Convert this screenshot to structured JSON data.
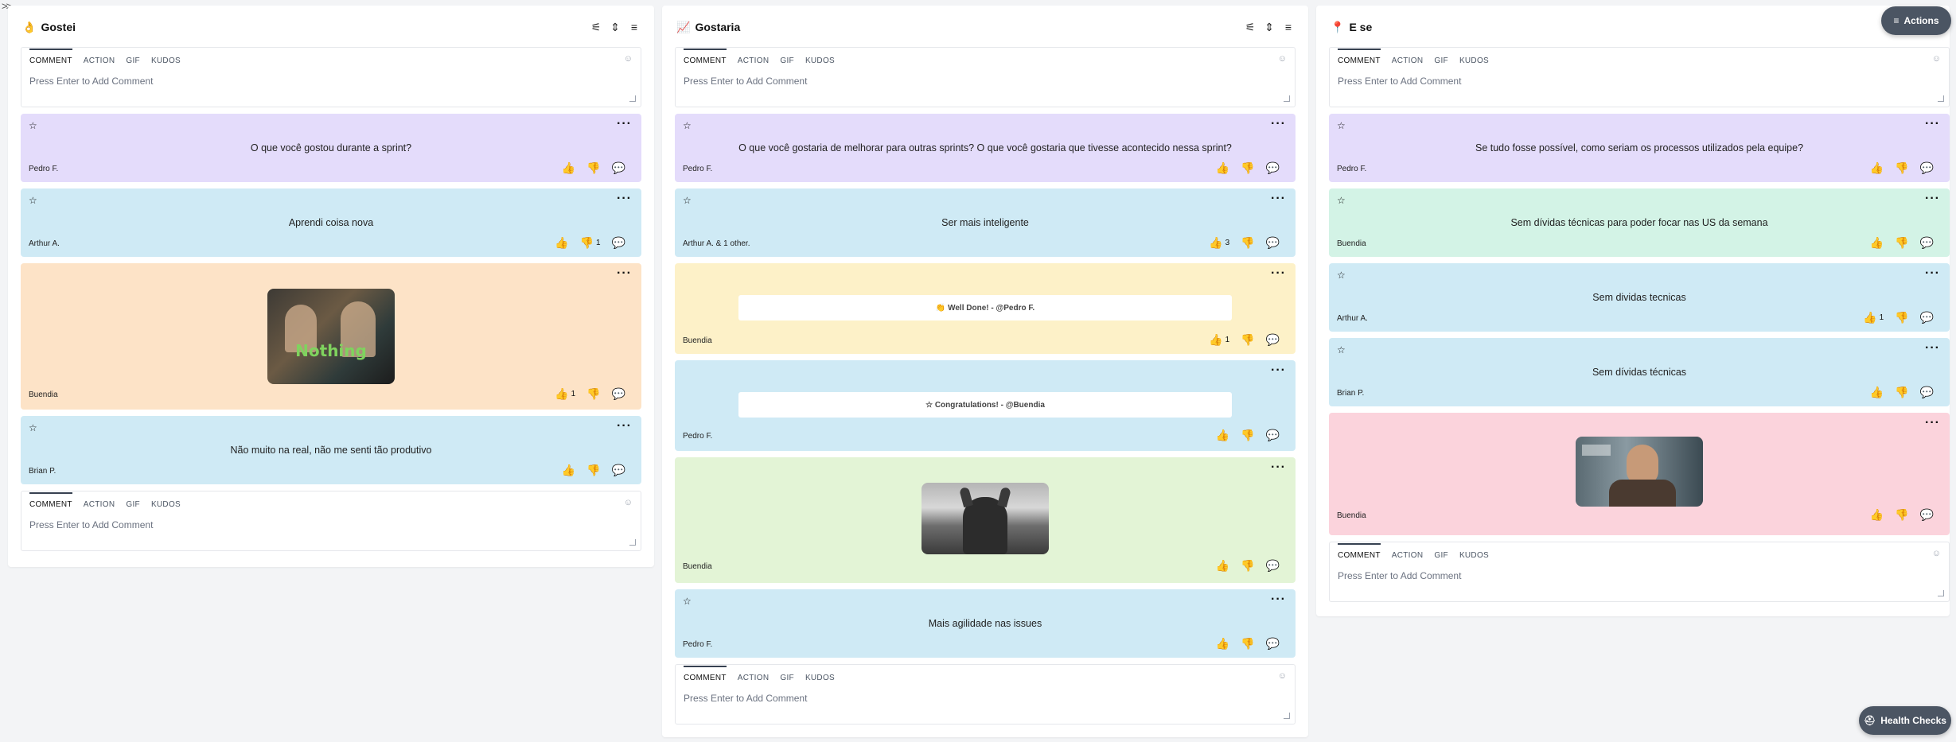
{
  "columns": [
    {
      "icon": "👌",
      "title": "Gostei",
      "composer_top": {
        "tabs": [
          "COMMENT",
          "ACTION",
          "GIF",
          "KUDOS"
        ],
        "placeholder": "Press Enter to Add Comment"
      },
      "cards": [
        {
          "text": "O que você gostou durante a sprint?",
          "author": "Pedro F.",
          "color": "#e4dcfb",
          "likes": "",
          "dislikes": ""
        },
        {
          "text": "Aprendi coisa nova",
          "author": "Arthur A.",
          "color": "#cfeaf5",
          "likes": "",
          "dislikes": "1"
        },
        {
          "gif": "nothing",
          "gif_caption": "Nothing",
          "author": "Buendia",
          "color": "#fde3c7",
          "likes": "1",
          "dislikes": ""
        },
        {
          "text": "Não muito na real, não me senti tão produtivo",
          "author": "Brian P.",
          "color": "#cfeaf5",
          "likes": "",
          "dislikes": ""
        }
      ],
      "composer_bottom": {
        "tabs": [
          "COMMENT",
          "ACTION",
          "GIF",
          "KUDOS"
        ],
        "placeholder": "Press Enter to Add Comment"
      }
    },
    {
      "icon": "📈",
      "title": "Gostaria",
      "composer_top": {
        "tabs": [
          "COMMENT",
          "ACTION",
          "GIF",
          "KUDOS"
        ],
        "placeholder": "Press Enter to Add Comment"
      },
      "cards": [
        {
          "text": "O que você gostaria de melhorar para outras sprints? O que você gostaria que tivesse acontecido nessa sprint?",
          "author": "Pedro F.",
          "color": "#e4dcfb",
          "likes": "",
          "dislikes": ""
        },
        {
          "text": "Ser mais inteligente",
          "author": "Arthur A. & 1 other.",
          "color": "#cfeaf5",
          "likes": "3",
          "dislikes": ""
        },
        {
          "kudos": "👏 Well Done! - @Pedro F.",
          "author": "Buendia",
          "color": "#fdf1c8",
          "likes": "1",
          "dislikes": ""
        },
        {
          "kudos": "☆ Congratulations! - @Buendia",
          "author": "Pedro F.",
          "color": "#cfeaf5",
          "likes": "",
          "dislikes": ""
        },
        {
          "gif": "horse",
          "author": "Buendia",
          "color": "#e3f4d6",
          "likes": "",
          "dislikes": ""
        },
        {
          "text": "Mais agilidade nas issues",
          "author": "Pedro F.",
          "color": "#cfeaf5",
          "likes": "",
          "dislikes": ""
        }
      ],
      "composer_bottom": {
        "tabs": [
          "COMMENT",
          "ACTION",
          "GIF",
          "KUDOS"
        ],
        "placeholder": "Press Enter to Add Comment"
      }
    },
    {
      "icon": "📍",
      "title": "E se",
      "composer_top": {
        "tabs": [
          "COMMENT",
          "ACTION",
          "GIF",
          "KUDOS"
        ],
        "placeholder": "Press Enter to Add Comment"
      },
      "cards": [
        {
          "text": "Se tudo fosse possível, como seriam os processos utilizados pela equipe?",
          "author": "Pedro F.",
          "color": "#e4dcfb",
          "likes": "",
          "dislikes": ""
        },
        {
          "text": "Sem dívidas técnicas para poder focar nas US da semana",
          "author": "Buendia",
          "color": "#d3f3e6",
          "likes": "",
          "dislikes": ""
        },
        {
          "text": "Sem dividas tecnicas",
          "author": "Arthur A.",
          "color": "#cfeaf5",
          "likes": "1",
          "dislikes": ""
        },
        {
          "text": "Sem dívidas técnicas",
          "author": "Brian P.",
          "color": "#cfeaf5",
          "likes": "",
          "dislikes": ""
        },
        {
          "gif": "arnold",
          "author": "Buendia",
          "color": "#fbd3dc",
          "likes": "",
          "dislikes": ""
        }
      ],
      "composer_bottom": {
        "tabs": [
          "COMMENT",
          "ACTION",
          "GIF",
          "KUDOS"
        ],
        "placeholder": "Press Enter to Add Comment"
      }
    }
  ],
  "actions_button": {
    "label": "Actions",
    "icon": "menu-icon"
  },
  "health_button": {
    "label": "Health Checks",
    "icon": "medkit-icon"
  },
  "icons": {
    "like": "thumbs-up-icon",
    "dislike": "thumbs-down-icon",
    "comment": "comment-icon",
    "star": "star-icon",
    "more": "more-icon"
  }
}
